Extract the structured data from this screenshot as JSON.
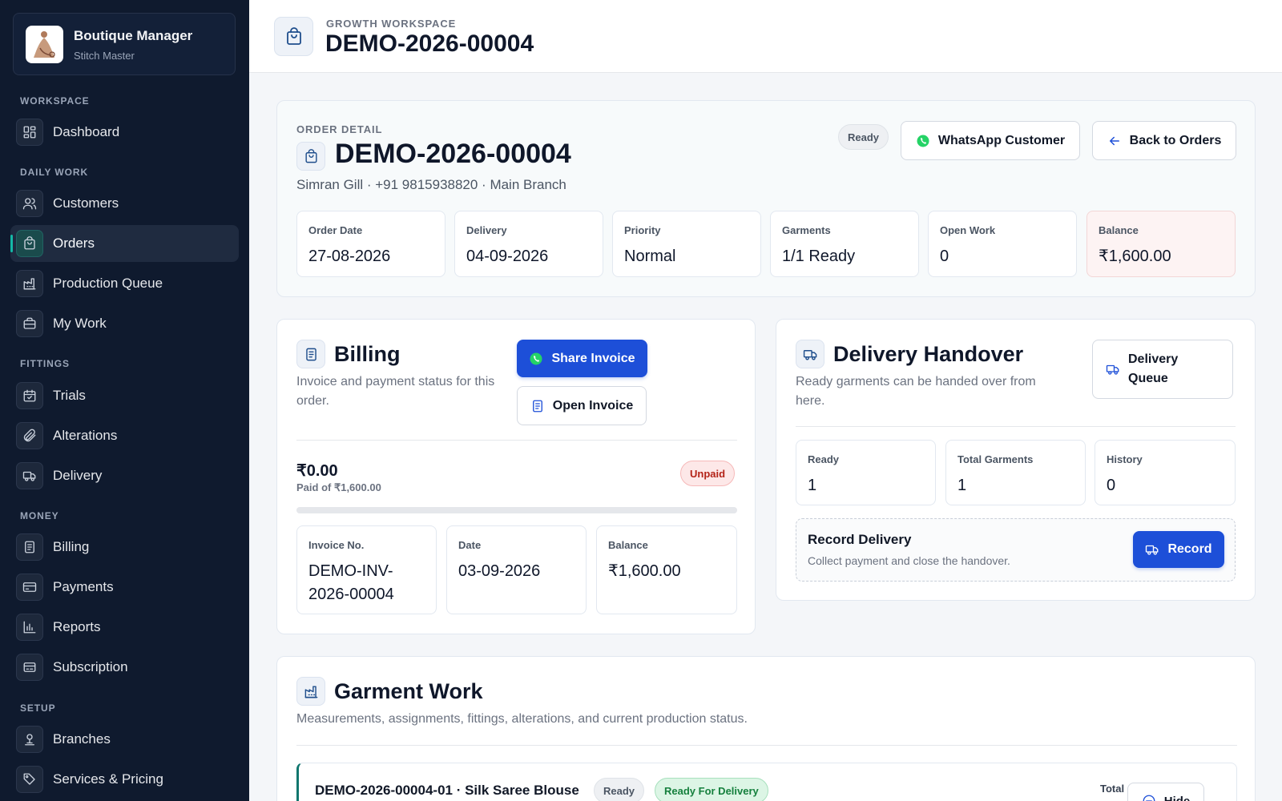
{
  "brand": {
    "name": "Boutique Manager",
    "subtitle": "Stitch Master"
  },
  "sidebar": {
    "sections": [
      {
        "label": "WORKSPACE"
      },
      {
        "label": "DAILY WORK"
      },
      {
        "label": "FITTINGS"
      },
      {
        "label": "MONEY"
      },
      {
        "label": "SETUP"
      }
    ],
    "items": [
      {
        "label": "Dashboard",
        "icon": "dashboard-icon"
      },
      {
        "label": "Customers",
        "icon": "users-icon"
      },
      {
        "label": "Orders",
        "icon": "shopping-bag-icon",
        "active": true
      },
      {
        "label": "Production Queue",
        "icon": "factory-icon"
      },
      {
        "label": "My Work",
        "icon": "briefcase-icon"
      },
      {
        "label": "Trials",
        "icon": "calendar-check-icon"
      },
      {
        "label": "Alterations",
        "icon": "paperclip-icon"
      },
      {
        "label": "Delivery",
        "icon": "truck-icon"
      },
      {
        "label": "Billing",
        "icon": "receipt-icon"
      },
      {
        "label": "Payments",
        "icon": "credit-card-icon"
      },
      {
        "label": "Reports",
        "icon": "bar-chart-icon"
      },
      {
        "label": "Subscription",
        "icon": "subscription-icon"
      },
      {
        "label": "Branches",
        "icon": "map-pin-icon"
      },
      {
        "label": "Services & Pricing",
        "icon": "tag-icon"
      }
    ]
  },
  "header": {
    "eyebrow": "GROWTH WORKSPACE",
    "title": "DEMO-2026-00004"
  },
  "order": {
    "eyebrow": "ORDER DETAIL",
    "title": "DEMO-2026-00004",
    "subtitle": "Simran Gill · +91 9815938820 · Main Branch",
    "status": "Ready",
    "whatsapp_label": "WhatsApp Customer",
    "back_label": "Back to Orders",
    "stats": [
      {
        "label": "Order Date",
        "value": "27-08-2026"
      },
      {
        "label": "Delivery",
        "value": "04-09-2026"
      },
      {
        "label": "Priority",
        "value": "Normal"
      },
      {
        "label": "Garments",
        "value": "1/1 Ready"
      },
      {
        "label": "Open Work",
        "value": "0"
      },
      {
        "label": "Balance",
        "value": "₹1,600.00"
      }
    ]
  },
  "billing": {
    "title": "Billing",
    "description": "Invoice and payment status for this order.",
    "share_label": "Share Invoice",
    "open_label": "Open Invoice",
    "amount_paid": "₹0.00",
    "paid_of": "Paid of ₹1,600.00",
    "payment_status": "Unpaid",
    "paid_fraction": 0,
    "stats": [
      {
        "label": "Invoice No.",
        "value": "DEMO-INV-2026-00004"
      },
      {
        "label": "Date",
        "value": "03-09-2026"
      },
      {
        "label": "Balance",
        "value": "₹1,600.00"
      }
    ]
  },
  "delivery": {
    "title": "Delivery Handover",
    "description": "Ready garments can be handed over from here.",
    "queue_label": "Delivery Queue",
    "stats": [
      {
        "label": "Ready",
        "value": "1"
      },
      {
        "label": "Total Garments",
        "value": "1"
      },
      {
        "label": "History",
        "value": "0"
      }
    ],
    "record_title": "Record Delivery",
    "record_desc": "Collect payment and close the handover.",
    "record_button": "Record"
  },
  "garment_work": {
    "title": "Garment Work",
    "description": "Measurements, assignments, fittings, alterations, and current production status.",
    "rows": [
      {
        "name": "DEMO-2026-00004-01 · Silk Saree Blouse",
        "status": "Ready",
        "stage": "Ready For Delivery",
        "total_label": "Total",
        "hide_label": "Hide"
      }
    ]
  },
  "colors": {
    "sidebar_bg": "#0f1a2e",
    "accent": "#1d4fd8",
    "active_indicator": "#14b8a6",
    "whatsapp": "#25d366"
  }
}
